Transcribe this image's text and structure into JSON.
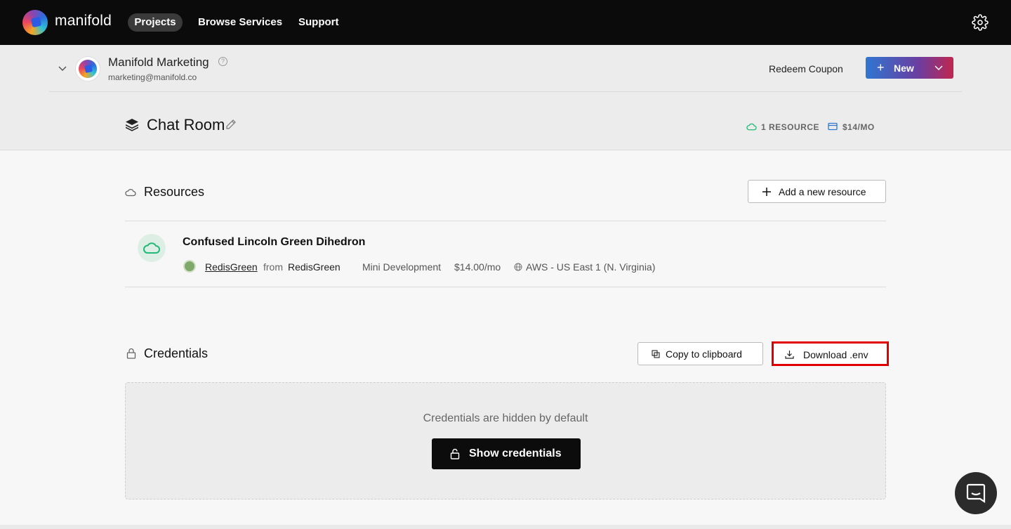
{
  "nav": {
    "brand": "manifold",
    "items": [
      {
        "label": "Projects",
        "active": true
      },
      {
        "label": "Browse Services",
        "active": false
      },
      {
        "label": "Support",
        "active": false
      }
    ],
    "settings_icon": "gear-icon"
  },
  "team": {
    "name": "Manifold Marketing",
    "email": "marketing@manifold.co",
    "help_glyph": "?",
    "redeem_label": "Redeem Coupon",
    "new_label": "New"
  },
  "project": {
    "title": "Chat Room",
    "resource_count": "1 RESOURCE",
    "cost": "$14/MO"
  },
  "resources": {
    "section_title": "Resources",
    "add_label": "Add a new resource",
    "items": [
      {
        "name": "Confused Lincoln Green Dihedron",
        "product": "RedisGreen",
        "from": "from",
        "vendor": "RedisGreen",
        "plan": "Mini Development",
        "price": "$14.00/mo",
        "region": "AWS - US East 1 (N. Virginia)"
      }
    ]
  },
  "credentials": {
    "section_title": "Credentials",
    "copy_label": "Copy to clipboard",
    "download_label": "Download .env",
    "hidden_message": "Credentials are hidden by default",
    "show_label": "Show credentials"
  },
  "colors": {
    "topbar": "#0b0b0b",
    "accent_green": "#1fb978",
    "highlight": "#e00000",
    "new_gradient_start": "#2f76d1",
    "new_gradient_end": "#c1264f"
  }
}
